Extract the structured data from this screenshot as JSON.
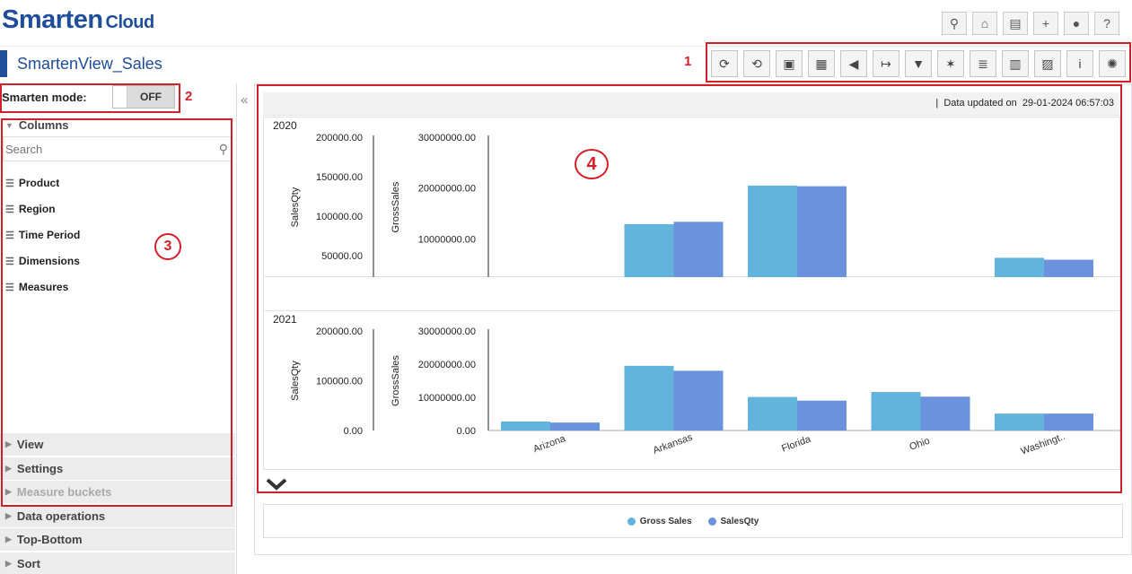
{
  "app": {
    "logo_main": "Smarten",
    "logo_sub": "Cloud",
    "title": "SmartenView_Sales"
  },
  "top_icons": [
    "search-icon",
    "home-icon",
    "folder-open-icon",
    "plus-icon",
    "user-icon",
    "help-icon"
  ],
  "top_glyphs": [
    "⚲",
    "⌂",
    "▤",
    "+",
    "●",
    "?"
  ],
  "toolbar_icons": [
    "refresh-icon",
    "globe-refresh-icon",
    "save-icon",
    "save-as-icon",
    "announce-icon",
    "export-icon",
    "filter-icon",
    "magic-wand-icon",
    "list-view-icon",
    "newspaper-icon",
    "image-icon",
    "info-icon",
    "gear-icon"
  ],
  "toolbar_glyphs": [
    "⟳",
    "⟲",
    "▣",
    "▦",
    "◀",
    "↦",
    "▼",
    "✶",
    "≣",
    "▥",
    "▨",
    "i",
    "✺"
  ],
  "markers": {
    "m1": "1",
    "m2": "2",
    "m3": "3",
    "m4": "4"
  },
  "smarten_mode": {
    "label": "Smarten mode:",
    "state": "OFF"
  },
  "sidebar": {
    "columns_label": "Columns",
    "search_placeholder": "Search",
    "items": [
      "Product",
      "Region",
      "Time Period",
      "Dimensions",
      "Measures"
    ],
    "sections": [
      "View",
      "Settings",
      "Measure buckets",
      "Data operations",
      "Top-Bottom",
      "Sort"
    ]
  },
  "collapse_glyph": "«",
  "data_updated": {
    "label": "Data updated on",
    "value": "29-01-2024 06:57:03"
  },
  "colors": {
    "gross_sales": "#62b4dc",
    "sales_qty": "#6b93dd",
    "accent": "#1f4e9a",
    "marker": "#d32028"
  },
  "chart_data": [
    {
      "type": "bar",
      "panel": "2020",
      "categories": [
        "Arizona",
        "Arkansas",
        "Florida",
        "Ohio",
        "Washingt.."
      ],
      "series": [
        {
          "name": "Gross Sales",
          "values": [
            null,
            12900000,
            20500000,
            null,
            6300000
          ]
        },
        {
          "name": "SalesQty",
          "values": [
            null,
            93000,
            138000,
            null,
            45000
          ]
        }
      ],
      "axes": [
        {
          "title": "SalesQty",
          "ticks": [
            "200000.00",
            "150000.00",
            "100000.00",
            "50000.00"
          ],
          "ylim": [
            23000,
            200000
          ]
        },
        {
          "title": "GrossSales",
          "ticks": [
            "30000000.00",
            "20000000.00",
            "10000000.00"
          ],
          "ylim": [
            2500000,
            30000000
          ]
        }
      ]
    },
    {
      "type": "bar",
      "panel": "2021",
      "categories": [
        "Arizona",
        "Arkansas",
        "Florida",
        "Ohio",
        "Washingt.."
      ],
      "series": [
        {
          "name": "Gross Sales",
          "values": [
            2700000,
            19500000,
            10100000,
            11600000,
            5100000
          ]
        },
        {
          "name": "SalesQty",
          "values": [
            16000,
            120000,
            60000,
            68000,
            34000
          ]
        }
      ],
      "axes": [
        {
          "title": "SalesQty",
          "ticks": [
            "200000.00",
            "100000.00",
            "0.00"
          ],
          "ylim": [
            0,
            200000
          ]
        },
        {
          "title": "GrossSales",
          "ticks": [
            "30000000.00",
            "20000000.00",
            "10000000.00",
            "0.00"
          ],
          "ylim": [
            0,
            30000000
          ]
        }
      ]
    }
  ],
  "legend": [
    "Gross Sales",
    "SalesQty"
  ]
}
